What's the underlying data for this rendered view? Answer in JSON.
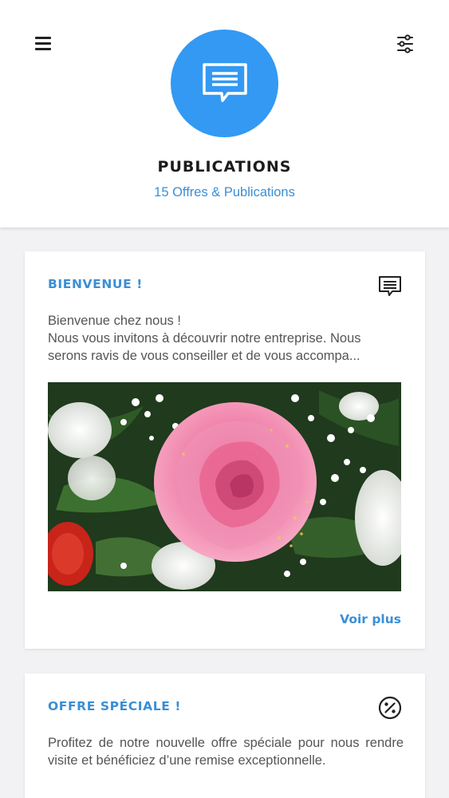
{
  "header": {
    "title": "PUBLICATIONS",
    "subtitle": "15 Offres & Publications",
    "icon": "message-icon"
  },
  "menu": {
    "icon": "hamburger-menu-icon"
  },
  "filter": {
    "icon": "sliders-icon"
  },
  "accent_color": "#3399f3",
  "cards": [
    {
      "title": "BIENVENUE !",
      "icon": "message-icon",
      "text_line1": "Bienvenue chez nous !",
      "text_line2": "Nous vous invitons à découvrir notre entreprise. Nous serons ravis de vous conseiller et de vous accompa...",
      "image": "pink-rose-bouquet",
      "link": "Voir plus"
    },
    {
      "title": "OFFRE SPÉCIALE !",
      "icon": "percent-badge-icon",
      "text": "Profitez de notre nouvelle offre spéciale pour nous rendre visite et bénéficiez d’une remise exceptionnelle."
    }
  ]
}
